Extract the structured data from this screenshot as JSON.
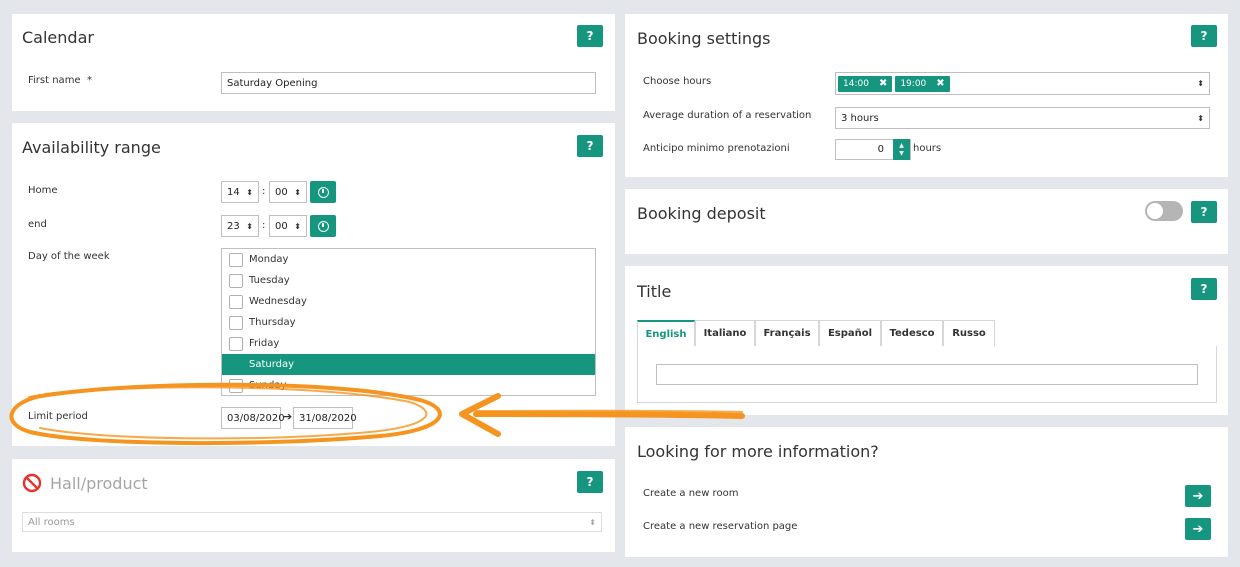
{
  "calendar": {
    "title": "Calendar",
    "help": "?",
    "first_name_label": "First name",
    "required_mark": "*",
    "first_name_value": "Saturday Opening"
  },
  "availability": {
    "title": "Availability range",
    "help": "?",
    "home_label": "Home",
    "home_hour": "14",
    "home_min": "00",
    "end_label": "end",
    "end_hour": "23",
    "end_min": "00",
    "time_sep": ":",
    "day_label": "Day of the week",
    "days": [
      "Monday",
      "Tuesday",
      "Wednesday",
      "Thursday",
      "Friday",
      "Saturday",
      "Sunday"
    ],
    "selected_day": "Saturday",
    "limit_label": "Limit period",
    "limit_from": "03/08/2020",
    "limit_to": "31/08/2020",
    "limit_arrow": "➔"
  },
  "hall": {
    "title": "Hall/product",
    "help": "?",
    "select_value": "All rooms"
  },
  "booking_settings": {
    "title": "Booking settings",
    "help": "?",
    "hours_label": "Choose hours",
    "hours_tags": [
      "14:00",
      "19:00"
    ],
    "tag_remove": "✖",
    "duration_label": "Average duration of a reservation",
    "duration_value": "3 hours",
    "advance_label": "Anticipo minimo prenotazioni",
    "advance_value": "0",
    "advance_unit": "hours"
  },
  "deposit": {
    "title": "Booking deposit",
    "help": "?",
    "toggle_on": false
  },
  "title_panel": {
    "title": "Title",
    "help": "?",
    "tabs": [
      "English",
      "Italiano",
      "Français",
      "Español",
      "Tedesco",
      "Russo"
    ],
    "active_tab": "English",
    "input_value": ""
  },
  "more_info": {
    "title": "Looking for more information?",
    "create_room": "Create a new room",
    "create_page": "Create a new reservation page",
    "go_arrow": "➔"
  },
  "colors": {
    "accent": "#16967f",
    "highlight": "#f5941f",
    "background": "#e3e6ea"
  }
}
